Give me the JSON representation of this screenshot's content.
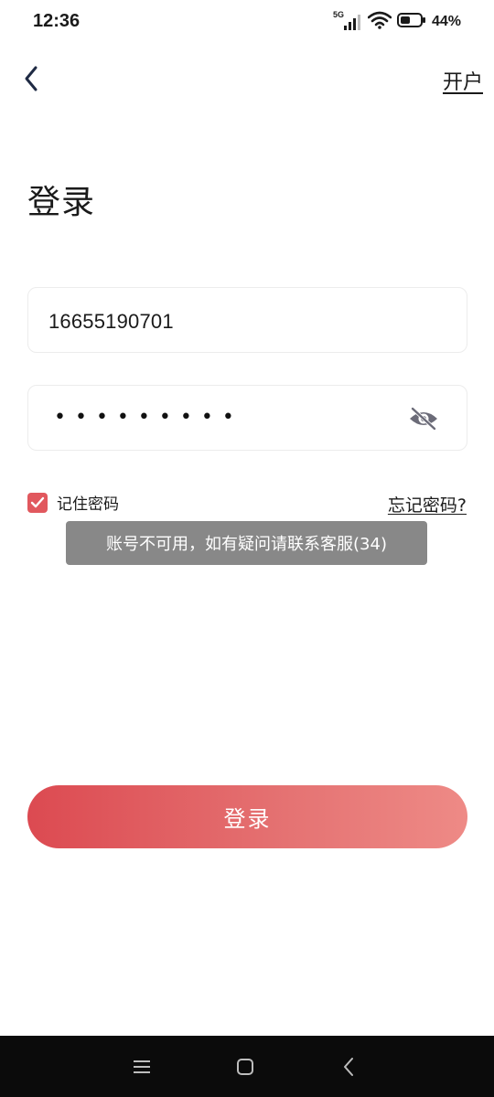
{
  "status_bar": {
    "time": "12:36",
    "network": "5G",
    "battery_percent": "44%",
    "battery_level": 0.44,
    "icons": [
      "signal-icon",
      "wifi-icon",
      "battery-icon"
    ]
  },
  "header": {
    "back_icon": "chevron-left-icon",
    "open_account_label": "开户"
  },
  "page": {
    "title": "登录"
  },
  "form": {
    "phone_value": "16655190701",
    "password_masked": "•••••••••",
    "password_toggle_icon": "eye-hidden-icon",
    "remember_label": "记住密码",
    "remember_checked": true,
    "forgot_label": "忘记密码?"
  },
  "toast": {
    "message": "账号不可用，如有疑问请联系客服(34)"
  },
  "login_button": {
    "label": "登录"
  },
  "colors": {
    "accent": "#e1585e",
    "gradient_start": "#dc4a51",
    "gradient_end": "#ee8a86",
    "toast_bg": "#888888",
    "nav_bg": "#0b0b0b"
  },
  "nav": {
    "icons": [
      "menu-icon",
      "home-icon",
      "back-icon"
    ]
  }
}
